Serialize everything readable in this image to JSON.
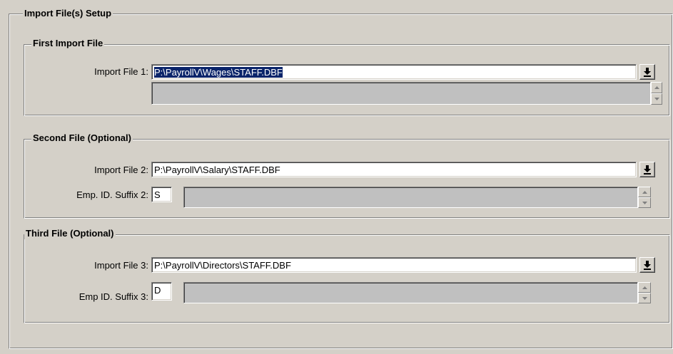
{
  "setup": {
    "title": "Import File(s) Setup",
    "first": {
      "title": "First Import File",
      "file_label": "Import File 1:",
      "file_value": "P:\\PayrollV\\Wages\\STAFF.DBF"
    },
    "second": {
      "title": "Second File (Optional)",
      "file_label": "Import File 2:",
      "file_value": "P:\\PayrollV\\Salary\\STAFF.DBF",
      "suffix_label": "Emp. ID. Suffix 2:",
      "suffix_value": "S"
    },
    "third": {
      "title": "Third File (Optional)",
      "file_label": "Import File 3:",
      "file_value": "P:\\PayrollV\\Directors\\STAFF.DBF",
      "suffix_label": "Emp ID. Suffix 3:",
      "suffix_value": "D"
    }
  },
  "icons": {
    "browse": "download-arrow-icon",
    "spin_up": "spin-up-icon",
    "spin_down": "spin-down-icon"
  }
}
